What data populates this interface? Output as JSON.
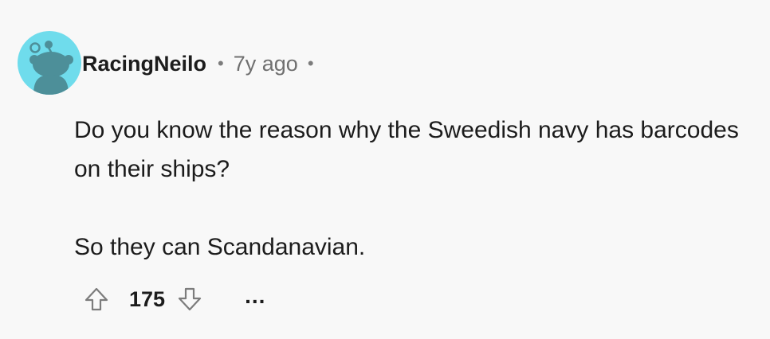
{
  "comment": {
    "author": "RacingNeilo",
    "separator": "•",
    "timestamp": "7y ago",
    "body": {
      "paragraph_1": "Do you know the reason why the Sweedish navy has barcodes on their ships?",
      "paragraph_2": "So they can Scandanavian."
    },
    "score": "175",
    "more_label": "..."
  },
  "icons": {
    "avatar": "reddit-snoo-avatar",
    "upvote": "arrow-up-icon",
    "downvote": "arrow-down-icon",
    "more": "ellipsis-icon"
  },
  "colors": {
    "background": "#f8f8f8",
    "avatar_background": "#6fdcec",
    "text": "#1c1c1c",
    "muted": "#6f6f6f"
  }
}
